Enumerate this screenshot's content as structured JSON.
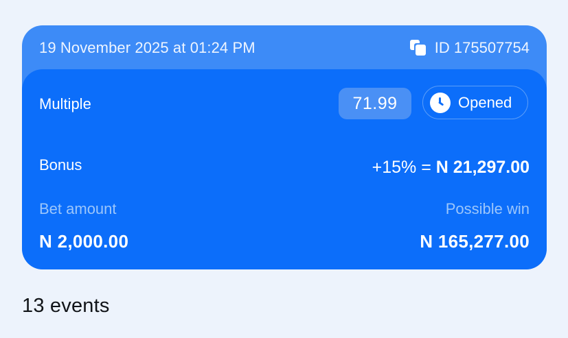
{
  "ticket": {
    "date": "19 November 2025 at 01:24 PM",
    "id_label": "ID 175507754",
    "bet_type": "Multiple",
    "odds": "71.99",
    "status": "Opened",
    "bonus_label": "Bonus",
    "bonus_percent": "+15% = ",
    "bonus_amount": "N 21,297.00",
    "bet_amount_label": "Bet amount",
    "bet_amount": "N 2,000.00",
    "possible_win_label": "Possible win",
    "possible_win": "N 165,277.00"
  },
  "events": {
    "title": "13 events"
  },
  "icons": {
    "copy": "copy-icon",
    "status": "clock-icon"
  },
  "colors": {
    "card_header": "#3d8bf7",
    "card_body": "#0c6efa",
    "page_background": "#edf3fc"
  }
}
